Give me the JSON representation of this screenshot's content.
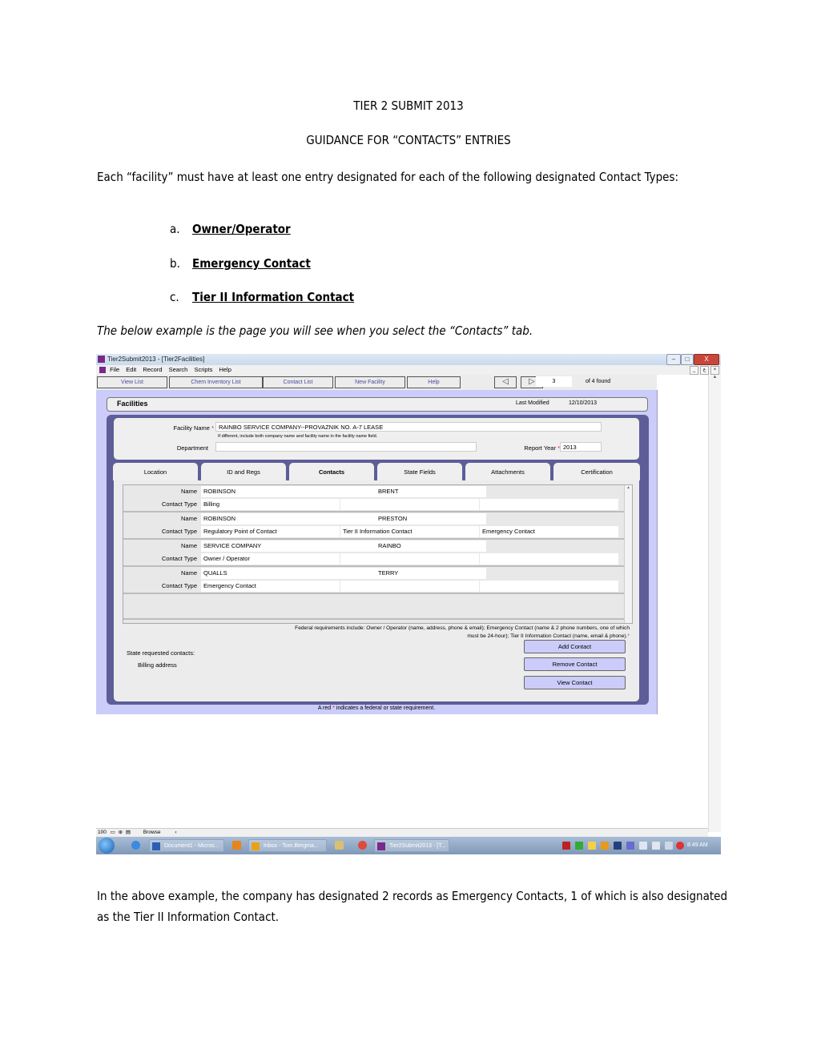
{
  "document": {
    "title": "TIER 2 SUBMIT 2013",
    "subtitle": "GUIDANCE FOR “CONTACTS” ENTRIES",
    "intro": "Each “facility” must have at least one entry designated for each of the following designated Contact Types:",
    "contact_types": [
      {
        "marker": "a.",
        "label": "Owner/Operator"
      },
      {
        "marker": "b.",
        "label": "Emergency Contact"
      },
      {
        "marker": "c.",
        "label": "Tier II Information Contact"
      }
    ],
    "example_caption": "The below example is the page you will see when you select the “Contacts” tab.",
    "conclusion": "In the above example, the company has designated 2 records as Emergency Contacts, 1 of which is also designated as the Tier II Information Contact."
  },
  "screenshot": {
    "window_title": "Tier2Submit2013 - [Tier2Facilities]",
    "window_buttons": {
      "minimize": "–",
      "maximize": "□",
      "close": "X"
    },
    "menu": [
      "File",
      "Edit",
      "Record",
      "Search",
      "Scripts",
      "Help"
    ],
    "mdi_buttons": [
      "_",
      "ع",
      "×"
    ],
    "toolbar": [
      "View List",
      "Chem Inventory List",
      "Contact List",
      "New Facility",
      "Help"
    ],
    "nav": {
      "prev_icon": "◁",
      "next_icon": "▷",
      "record": "3",
      "found": "of 4 found"
    },
    "header": {
      "title": "Facilities",
      "last_modified_label": "Last Modified",
      "last_modified": "12/10/2013"
    },
    "form": {
      "facility_name_label": "Facility Name",
      "facility_name": "RAINBO SERVICE COMPANY--PROVAZNIK NO. A-7 LEASE",
      "facility_hint": "If different, include both company name and facility name in the facility name field.",
      "department_label": "Department",
      "department": "",
      "report_year_label": "Report Year",
      "report_year": "2013",
      "required_mark": "*"
    },
    "tabs": [
      "Location",
      "ID and Regs",
      "Contacts",
      "State Fields",
      "Attachments",
      "Certification"
    ],
    "active_tab": "Contacts",
    "contacts": [
      {
        "name_label": "Name",
        "last": "ROBINSON",
        "first": "BRENT",
        "type_label": "Contact Type",
        "types": [
          "Billing",
          "",
          ""
        ]
      },
      {
        "name_label": "Name",
        "last": "ROBINSON",
        "first": "PRESTON",
        "type_label": "Contact Type",
        "types": [
          "Regulatory Point of Contact",
          "Tier II Information Contact",
          "Emergency Contact"
        ]
      },
      {
        "name_label": "Name",
        "last": "SERVICE COMPANY",
        "first": "RAINBO",
        "type_label": "Contact Type",
        "types": [
          "Owner / Operator",
          "",
          ""
        ]
      },
      {
        "name_label": "Name",
        "last": "QUALLS",
        "first": "TERRY",
        "type_label": "Contact Type",
        "types": [
          "Emergency Contact",
          "",
          ""
        ]
      }
    ],
    "federal_requirements": "Federal requirements include: Owner / Operator (name, address, phone & email); Emergency Contact (name & 2 phone numbers, one of which must be 24-hour); Tier II Information Contact (name, email & phone).",
    "state_requested_label": "State requested contacts:",
    "state_requested_item": "Billing address",
    "buttons": {
      "add": "Add Contact",
      "remove": "Remove Contact",
      "view": "View Contact"
    },
    "footer_note_pre": "A red",
    "footer_note_post": "indicates a federal or state requirement.",
    "status_bar": {
      "zoom": "100",
      "mode": "Browse"
    },
    "taskbar": {
      "items": [
        "Document1 - Micros...",
        "Inbox - Tom.Bergma...",
        "Tier2Submit2013 - [T..."
      ],
      "clock": "8:49 AM"
    }
  }
}
